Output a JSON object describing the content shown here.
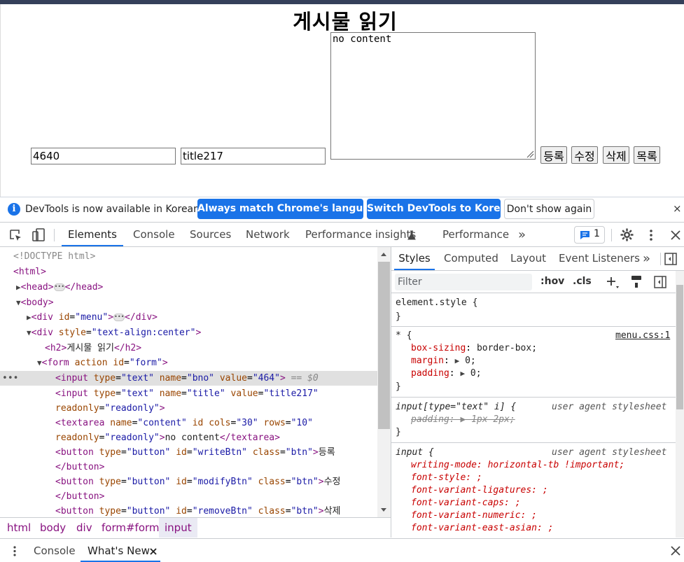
{
  "page": {
    "title": "게시물 읽기",
    "bno_value": "4640",
    "title_value": "title217",
    "content_value": "no content",
    "buttons": [
      "등록",
      "수정",
      "삭제",
      "목록"
    ]
  },
  "devtools": {
    "infobar": {
      "message": "DevTools is now available in Korean!",
      "btn_match": "Always match Chrome's language",
      "btn_switch": "Switch DevTools to Korean",
      "btn_dont_show": "Don't show again",
      "close": "×"
    },
    "tabs": [
      "Elements",
      "Console",
      "Sources",
      "Network",
      "Performance insights",
      "Performance"
    ],
    "more_tabs": "»",
    "issues_count": "1",
    "elements": {
      "doctype": "<!DOCTYPE html>",
      "html_open": "<html>",
      "head_open": "<head>",
      "head_close": "</head>",
      "body_open": "<body>",
      "div_open": "<div",
      "attr_id": "id",
      "menu_val": "\"menu\"",
      "div_close_bracket": ">",
      "div_close": "</div>",
      "attr_style": "style",
      "style_val": "\"text-align:center\"",
      "h2_open": "<h2>",
      "h2_text": "게시물 읽기",
      "h2_close": "</h2>",
      "form_open": "<form",
      "attr_action": "action",
      "form_val": "\"form\"",
      "input_open": "<input",
      "attr_type": "type",
      "text_val": "\"text\"",
      "attr_name": "name",
      "bno_val": "\"bno\"",
      "attr_value": "value",
      "value_464": "\"464\"",
      "eq_dollar": "== $0",
      "title_val": "\"title\"",
      "title217_val": "\"title217\"",
      "attr_readonly": "readonly",
      "readonly_val": "\"readonly\"",
      "textarea_open": "<textarea",
      "content_val": "\"content\"",
      "attr_cols": "cols",
      "cols_val": "\"30\"",
      "attr_rows": "rows",
      "rows_val": "\"10\"",
      "textarea_text": "no content",
      "textarea_close": "</textarea>",
      "button_open": "<button",
      "button_val": "\"button\"",
      "writeBtn_val": "\"writeBtn\"",
      "attr_class": "class",
      "btn_val": "\"btn\"",
      "write_text": "등록",
      "button_close": "</button>",
      "modifyBtn_val": "\"modifyBtn\"",
      "modify_text": "수정",
      "removeBtn_val": "\"removeBtn\"",
      "remove_text": "삭제",
      "gt": ">",
      "gt_close": ">"
    },
    "breadcrumbs": [
      "html",
      "body",
      "div",
      "form#form",
      "input"
    ],
    "styles_tabs": [
      "Styles",
      "Computed",
      "Layout",
      "Event Listeners"
    ],
    "filter_placeholder": "Filter",
    "hov": ":hov",
    "cls": ".cls",
    "styles": {
      "element_style": "element.style {",
      "close_brace": "}",
      "star_selector": "* {",
      "menu_src": "menu.css:1",
      "box_sizing_prop": "box-sizing",
      "box_sizing_val": "border-box;",
      "margin_prop": "margin",
      "margin_val": "0;",
      "padding_prop": "padding",
      "padding_val": "0;",
      "input_text_selector": "input[type=\"text\" i] {",
      "ua_label": "user agent stylesheet",
      "padding_struck": "padding: ▶ 1px 2px;",
      "input_selector": "input {",
      "writing_mode": "writing-mode: horizontal-tb !important;",
      "font_style": "font-style: ;",
      "font_variant_ligatures": "font-variant-ligatures: ;",
      "font_variant_caps": "font-variant-caps: ;",
      "font_variant_numeric": "font-variant-numeric: ;",
      "font_variant_east_asian": "font-variant-east-asian: ;"
    },
    "drawer_tabs": [
      "Console",
      "What's New"
    ]
  }
}
